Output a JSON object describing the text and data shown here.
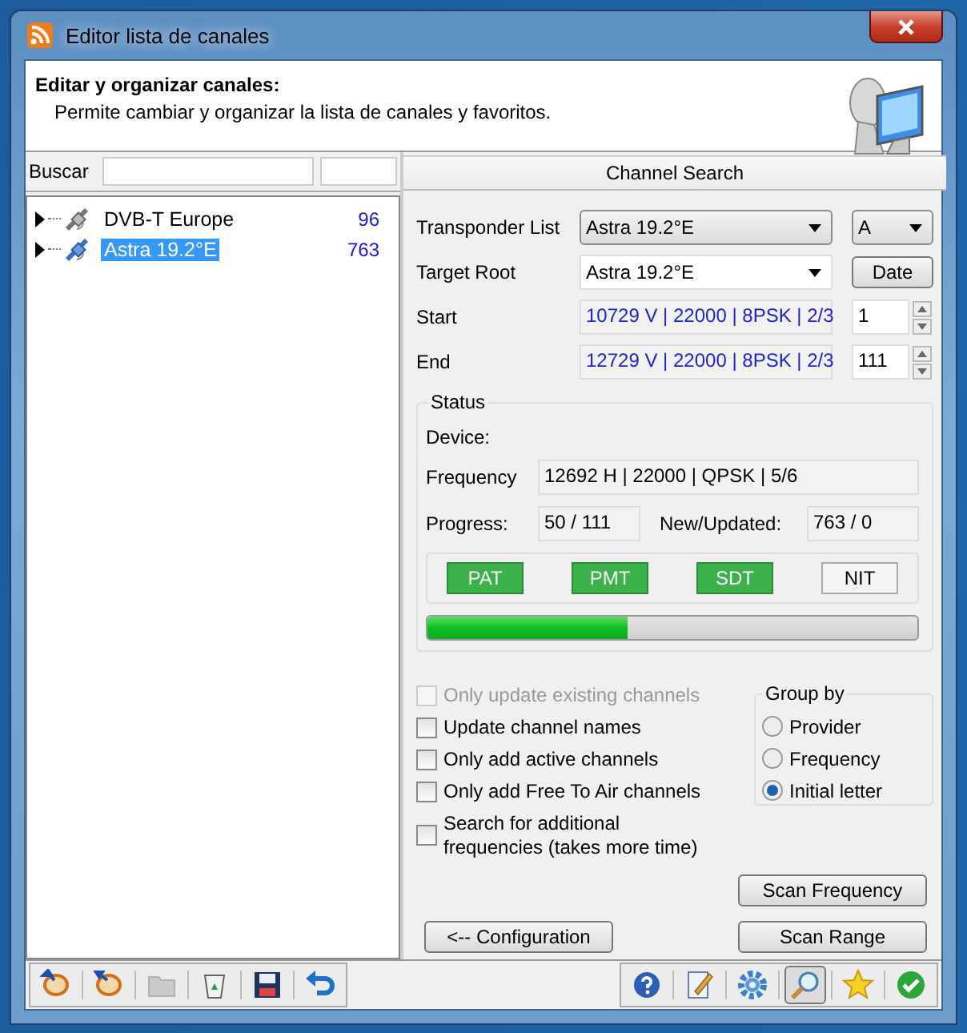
{
  "window": {
    "title": "Editor lista de canales"
  },
  "header": {
    "title": "Editar y organizar canales:",
    "subtitle": "Permite cambiar y organizar la lista de canales y favoritos."
  },
  "search": {
    "label": "Buscar"
  },
  "tree": {
    "items": [
      {
        "name": "DVB-T Europe",
        "count": "96",
        "expanded": false,
        "selected": false
      },
      {
        "name": "Astra 19.2°E",
        "count": "763",
        "expanded": false,
        "selected": true
      }
    ]
  },
  "channel_search": {
    "title": "Channel Search",
    "transponder_list": {
      "label": "Transponder List",
      "value": "Astra 19.2°E",
      "band": "A"
    },
    "target_root": {
      "label": "Target Root",
      "value": "Astra 19.2°E",
      "button": "Date"
    },
    "start": {
      "label": "Start",
      "value": "10729 V | 22000 | 8PSK | 2/3",
      "index": "1"
    },
    "end": {
      "label": "End",
      "value": "12729 V | 22000 | 8PSK | 2/3",
      "index": "111"
    },
    "status": {
      "title": "Status",
      "device_label": "Device:",
      "frequency_label": "Frequency",
      "frequency": "12692 H | 22000 | QPSK | 5/6",
      "progress_label": "Progress:",
      "progress": "50 / 111",
      "new_label": "New/Updated:",
      "new": "763 / 0",
      "tables": [
        {
          "label": "PAT",
          "on": true
        },
        {
          "label": "PMT",
          "on": true
        },
        {
          "label": "SDT",
          "on": true
        },
        {
          "label": "NIT",
          "on": false
        }
      ],
      "level": 0.41
    },
    "options": [
      {
        "label": "Only update existing channels",
        "checked": false,
        "disabled": true
      },
      {
        "label": "Update channel names",
        "checked": false,
        "disabled": false
      },
      {
        "label": "Only add active channels",
        "checked": false,
        "disabled": false
      },
      {
        "label": "Only add Free To Air  channels",
        "checked": false,
        "disabled": false
      },
      {
        "label": "Search for additional frequencies  (takes more time)",
        "checked": false,
        "disabled": false
      }
    ],
    "group_by": {
      "title": "Group by",
      "options": [
        {
          "label": "Provider",
          "selected": false
        },
        {
          "label": "Frequency",
          "selected": false
        },
        {
          "label": "Initial letter",
          "selected": true
        }
      ]
    },
    "buttons": {
      "scan_frequency": "Scan Frequency",
      "configuration": "<-- Configuration",
      "scan_range": "Scan Range"
    }
  },
  "toolbar": {
    "left": [
      {
        "kind": "import",
        "disabled": false,
        "selected": false
      },
      {
        "kind": "export",
        "disabled": false,
        "selected": false
      },
      {
        "kind": "folder",
        "disabled": true,
        "selected": false
      },
      {
        "kind": "recycle",
        "disabled": false,
        "selected": false
      },
      {
        "kind": "save",
        "disabled": false,
        "selected": false
      },
      {
        "kind": "undo",
        "disabled": false,
        "selected": false
      }
    ],
    "right": [
      {
        "kind": "help",
        "disabled": false,
        "selected": false
      },
      {
        "kind": "edit",
        "disabled": false,
        "selected": false
      },
      {
        "kind": "settings",
        "disabled": false,
        "selected": false
      },
      {
        "kind": "search",
        "disabled": false,
        "selected": true
      },
      {
        "kind": "star",
        "disabled": false,
        "selected": false
      },
      {
        "kind": "ok",
        "disabled": false,
        "selected": false
      }
    ]
  }
}
